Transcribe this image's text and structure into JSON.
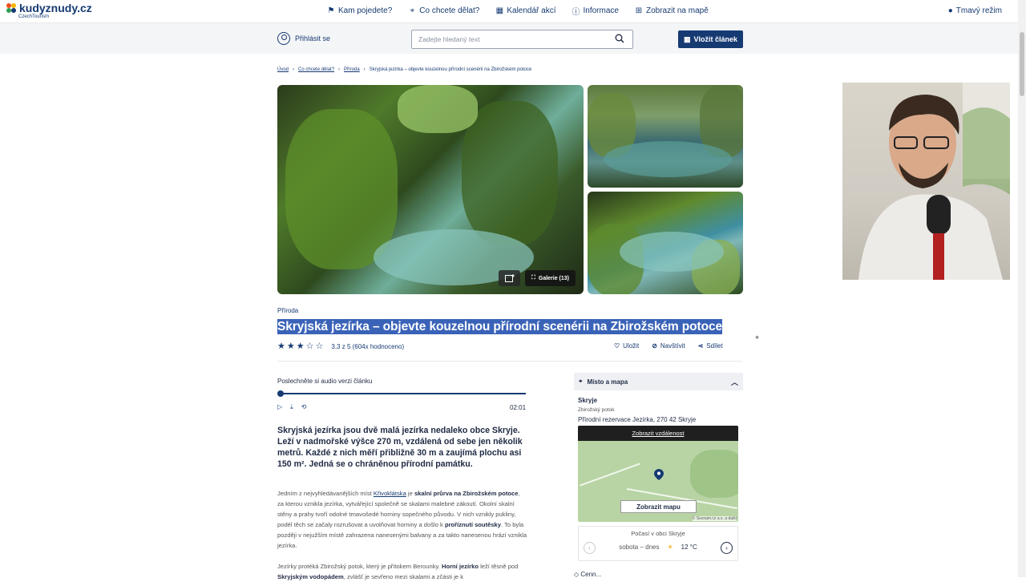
{
  "nav": {
    "logo_text": "kudyznudy.cz",
    "logo_sub": "CzechTourism",
    "items": [
      {
        "label": "Kam pojedete?",
        "icon": "signpost-icon"
      },
      {
        "label": "Co chcete dělat?",
        "icon": "pin-icon"
      },
      {
        "label": "Kalendář akcí",
        "icon": "calendar-icon"
      },
      {
        "label": "Informace",
        "icon": "info-icon"
      },
      {
        "label": "Zobrazit na mapě",
        "icon": "map-icon"
      }
    ],
    "dark_mode": "Tmavý režim"
  },
  "subbar": {
    "login": "Přihlásit se",
    "search_placeholder": "Zadejte hledaný text",
    "add_article": "Vložit článek"
  },
  "breadcrumb": [
    "Úvod",
    "Co chcete dělat?",
    "Příroda",
    "Skryjská jezírka – objevte kouzelnou přírodní scenérii na Zbirožském potoce"
  ],
  "gallery": {
    "label": "Galerie (13)"
  },
  "article": {
    "category": "Příroda",
    "title": "Skryjská jezírka – objevte kouzelnou přírodní scenérii na Zbirožském potoce",
    "rating_text": "3,3 z 5 (604x hodnoceno)",
    "rating_value": 3.3,
    "actions": {
      "save": "Uložit",
      "visit": "Navštívit",
      "share": "Sdílet"
    },
    "audio_title": "Poslechněte si audio verzi článku",
    "audio_time": "02:01",
    "lead": "Skryjská jezírka jsou dvě malá jezírka nedaleko obce Skryje. Leží v nadmořské výšce 270 m, vzdálená od sebe jen několik metrů. Každé z nich měří přibližně 30 m a zaujímá plochu asi 150 m².  Jedná se o chráněnou přírodní památku.",
    "p1_a": "Jedním z nejvyhledávanějších míst ",
    "p1_link": "Křivoklátska",
    "p1_b": " je ",
    "p1_bold1": "skalní průrva na Zbirožském potoce",
    "p1_c": ", za kterou vznikla jezírka, vytvářející společně se skalami malebné zákoutí. Okolní skalní stěny a prahy tvoří odolné tmavošedé horniny sopečného původu. V nich vznikly pukliny, podél těch se začaly rozrušovat a uvolňovat horniny a došlo k ",
    "p1_bold2": "proříznutí soutěsky",
    "p1_d": ". To byla později v nejužším místě zahrazena nanesenými balvany a za takto nanesenou hrází vznikla jezírka.",
    "p2_a": "Jezírky protéká Zbirožský potok, který je přítokem Berounky. ",
    "p2_bold1": "Horní jezírko",
    "p2_b": " leží těsně pod ",
    "p2_bold2": "Skryjským vodopádem",
    "p2_c": ", zvlášť je sevřeno mezi skalami a zčásti je k"
  },
  "sidebar": {
    "header": "Místo a mapa",
    "place_name": "Skryje",
    "place_sub": "Zbirožský potok",
    "place_addr": "Přírodní rezervace Jezírka, 270 42 Skryje",
    "map_distance": "Zobrazit vzdálenost",
    "map_button": "Zobrazit mapu",
    "map_copy": "© Seznam.cz a.s. a další",
    "weather_title": "Počasí v obci Skryje",
    "weather_day": "sobota – dnes",
    "weather_temp": "12 °C",
    "next_section": "Cenn..."
  },
  "colors": {
    "brand": "#163a72",
    "selection": "#3a63b8"
  }
}
